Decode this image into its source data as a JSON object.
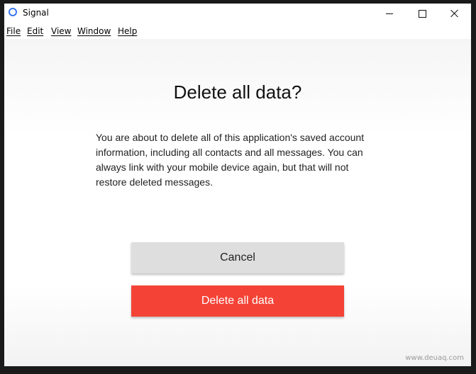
{
  "window": {
    "title": "Signal",
    "controls": {
      "minimize_icon": "minimize-icon",
      "maximize_icon": "maximize-icon",
      "close_icon": "close-icon"
    }
  },
  "menu": {
    "items": [
      {
        "label": "File"
      },
      {
        "label": "Edit"
      },
      {
        "label": "View"
      },
      {
        "label": "Window"
      },
      {
        "label": "Help"
      }
    ]
  },
  "dialog": {
    "title": "Delete all data?",
    "body": "You are about to delete all of this application's saved account information, including all contacts and all messages. You can always link with your mobile device again, but that will not restore deleted messages.",
    "cancel_label": "Cancel",
    "delete_label": "Delete all data"
  },
  "watermark": "www.deuaq.com",
  "colors": {
    "accent_blue": "#3a76f0",
    "danger_red": "#f44336",
    "cancel_gray": "#dedede"
  }
}
